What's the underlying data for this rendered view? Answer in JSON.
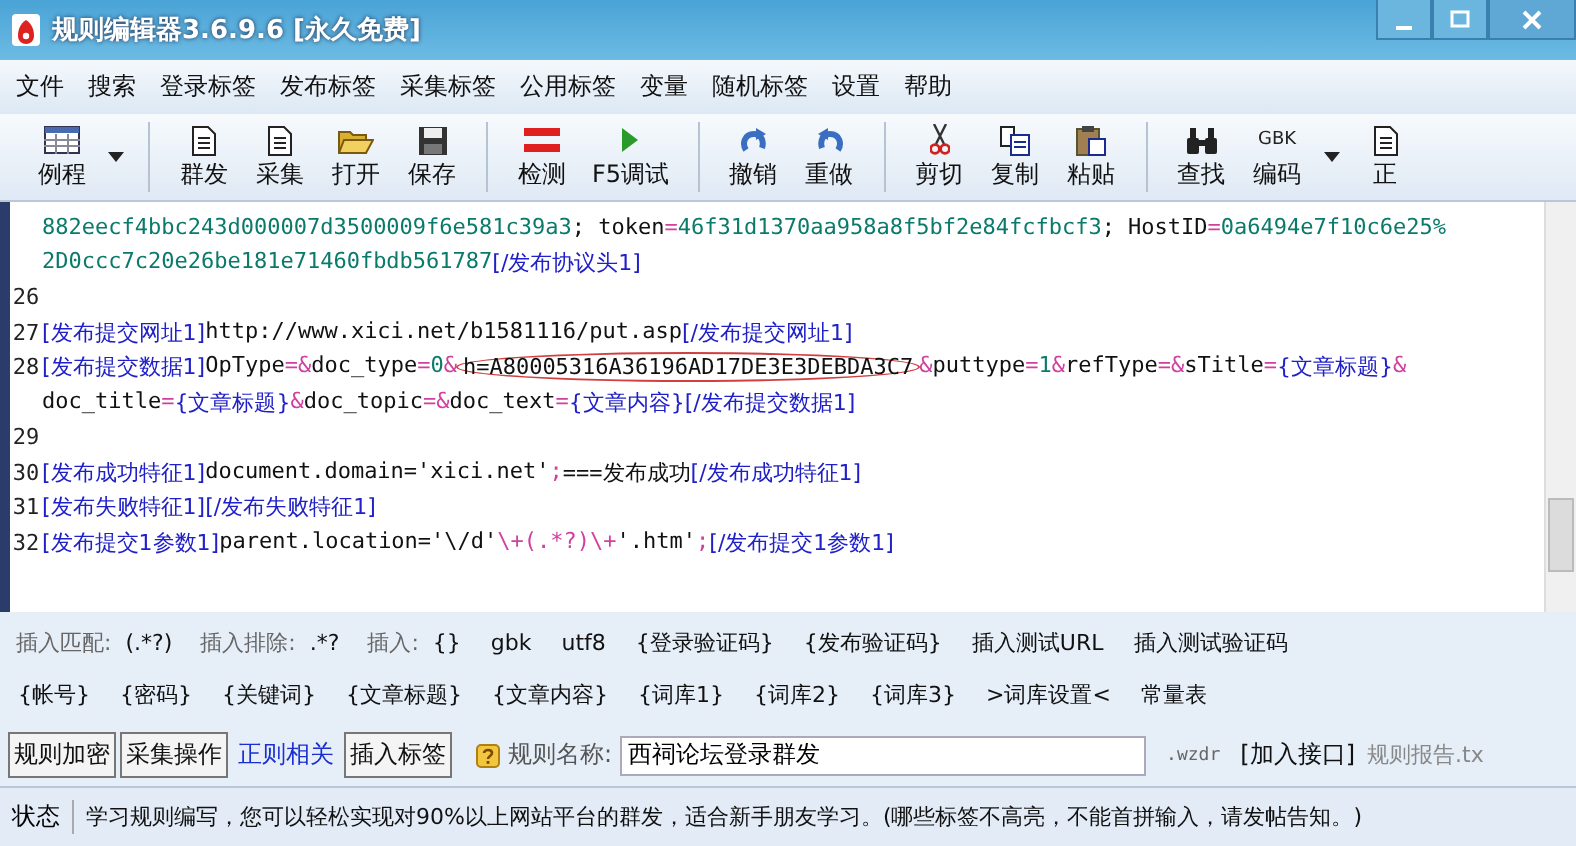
{
  "window": {
    "title": "规则编辑器3.6.9.6 [永久免费]"
  },
  "menu": [
    "文件",
    "搜索",
    "登录标签",
    "发布标签",
    "采集标签",
    "公用标签",
    "变量",
    "随机标签",
    "设置",
    "帮助"
  ],
  "toolbar": [
    {
      "kind": "grid",
      "label": "例程",
      "dropdown": true
    },
    {
      "kind": "sep"
    },
    {
      "kind": "doc",
      "label": "群发"
    },
    {
      "kind": "doc",
      "label": "采集"
    },
    {
      "kind": "folder",
      "label": "打开"
    },
    {
      "kind": "save",
      "label": "保存"
    },
    {
      "kind": "sep"
    },
    {
      "kind": "bars",
      "label": "检测"
    },
    {
      "kind": "play",
      "label": "F5调试"
    },
    {
      "kind": "sep"
    },
    {
      "kind": "undo",
      "label": "撤销"
    },
    {
      "kind": "redo",
      "label": "重做"
    },
    {
      "kind": "sep"
    },
    {
      "kind": "scissors",
      "label": "剪切"
    },
    {
      "kind": "copy",
      "label": "复制"
    },
    {
      "kind": "paste",
      "label": "粘贴"
    },
    {
      "kind": "sep"
    },
    {
      "kind": "binoculars",
      "label": "查找"
    },
    {
      "kind": "text",
      "icon_text": "GBK",
      "label": "编码",
      "dropdown": true
    },
    {
      "kind": "doc",
      "label": "正"
    }
  ],
  "editor": {
    "lines": [
      {
        "segments": [
          {
            "kind": "value",
            "text": "882eecf4bbc243d000007d3500009f6e581c39a3"
          },
          {
            "kind": "text",
            "text": "; token"
          },
          {
            "kind": "op",
            "text": "="
          },
          {
            "kind": "value",
            "text": "46f31d1370aa958a8f5bf2e84fcfbcf3"
          },
          {
            "kind": "text",
            "text": "; HostID"
          },
          {
            "kind": "op",
            "text": "="
          },
          {
            "kind": "value",
            "text": "0a6494e7f10c6e25%"
          }
        ]
      },
      {
        "segments": [
          {
            "kind": "value",
            "text": "2D0ccc7c20e26be181e71460fbdb561787"
          },
          {
            "kind": "tag",
            "text": "[/发布协议头1]"
          }
        ]
      },
      {
        "number": "26"
      },
      {
        "number": "27",
        "segments": [
          {
            "kind": "tag",
            "text": "[发布提交网址1]"
          },
          {
            "kind": "text",
            "text": "http://www.xici.net/b1581116/put.asp"
          },
          {
            "kind": "tag",
            "text": "[/发布提交网址1]"
          }
        ]
      },
      {
        "number": "28",
        "segments": [
          {
            "kind": "tag",
            "text": "[发布提交数据1]"
          },
          {
            "kind": "text",
            "text": "OpType"
          },
          {
            "kind": "op",
            "text": "=&"
          },
          {
            "kind": "text",
            "text": "doc_type"
          },
          {
            "kind": "op",
            "text": "="
          },
          {
            "kind": "value",
            "text": "0"
          },
          {
            "kind": "op",
            "text": "&"
          },
          {
            "kind": "text",
            "text": "h=A80005316A36196AD17DE3E3DEBDA3C7",
            "circled": true
          },
          {
            "kind": "op",
            "text": "&"
          },
          {
            "kind": "text",
            "text": "puttype"
          },
          {
            "kind": "op",
            "text": "="
          },
          {
            "kind": "value",
            "text": "1"
          },
          {
            "kind": "op",
            "text": "&"
          },
          {
            "kind": "text",
            "text": "refType"
          },
          {
            "kind": "op",
            "text": "=&"
          },
          {
            "kind": "text",
            "text": "sTitle"
          },
          {
            "kind": "op",
            "text": "="
          },
          {
            "kind": "tag",
            "text": "{文章标题}"
          },
          {
            "kind": "op",
            "text": "&"
          }
        ]
      },
      {
        "segments": [
          {
            "kind": "text",
            "text": "doc_title"
          },
          {
            "kind": "op",
            "text": "="
          },
          {
            "kind": "tag",
            "text": "{文章标题}"
          },
          {
            "kind": "op",
            "text": "&"
          },
          {
            "kind": "text",
            "text": "doc_topic"
          },
          {
            "kind": "op",
            "text": "=&"
          },
          {
            "kind": "text",
            "text": "doc_text"
          },
          {
            "kind": "op",
            "text": "="
          },
          {
            "kind": "tag",
            "text": "{文章内容}"
          },
          {
            "kind": "tag",
            "text": "[/发布提交数据1]"
          }
        ]
      },
      {
        "number": "29"
      },
      {
        "number": "30",
        "segments": [
          {
            "kind": "tag",
            "text": "[发布成功特征1]"
          },
          {
            "kind": "text",
            "text": "document.domain='xici.net'"
          },
          {
            "kind": "op",
            "text": ";"
          },
          {
            "kind": "text",
            "text": "===发布成功"
          },
          {
            "kind": "tag",
            "text": "[/发布成功特征1]"
          }
        ]
      },
      {
        "number": "31",
        "segments": [
          {
            "kind": "tag",
            "text": "[发布失败特征1]"
          },
          {
            "kind": "tag",
            "text": "[/发布失败特征1]"
          }
        ]
      },
      {
        "number": "32",
        "segments": [
          {
            "kind": "tag",
            "text": "[发布提交1参数1]"
          },
          {
            "kind": "text",
            "text": "parent.location='\\/d'"
          },
          {
            "kind": "op",
            "text": "\\+(.*?)\\+"
          },
          {
            "kind": "text",
            "text": "'.htm'"
          },
          {
            "kind": "op",
            "text": ";"
          },
          {
            "kind": "tag",
            "text": "[/发布提交1参数1]"
          }
        ]
      }
    ]
  },
  "insert_rows": [
    [
      {
        "kind": "label",
        "text": "插入匹配:"
      },
      {
        "kind": "button",
        "text": "(.*?)"
      },
      {
        "kind": "label",
        "text": "插入排除:"
      },
      {
        "kind": "button",
        "text": ".*?"
      },
      {
        "kind": "label",
        "text": "插入:"
      },
      {
        "kind": "button",
        "text": "{}"
      },
      {
        "kind": "button",
        "text": "gbk"
      },
      {
        "kind": "button",
        "text": "utf8"
      },
      {
        "kind": "button",
        "text": "{登录验证码}"
      },
      {
        "kind": "button",
        "text": "{发布验证码}"
      },
      {
        "kind": "button",
        "text": "插入测试URL"
      },
      {
        "kind": "button",
        "text": "插入测试验证码"
      }
    ],
    [
      {
        "kind": "button",
        "text": "{帐号}"
      },
      {
        "kind": "button",
        "text": "{密码}"
      },
      {
        "kind": "button",
        "text": "{关键词}"
      },
      {
        "kind": "button",
        "text": "{文章标题}"
      },
      {
        "kind": "button",
        "text": "{文章内容}"
      },
      {
        "kind": "button",
        "text": "{词库1}"
      },
      {
        "kind": "button",
        "text": "{词库2}"
      },
      {
        "kind": "button",
        "text": "{词库3}"
      },
      {
        "kind": "button",
        "text": ">词库设置<"
      },
      {
        "kind": "button",
        "text": "常量表"
      }
    ]
  ],
  "tabs": [
    {
      "label": "规则加密",
      "selected": false
    },
    {
      "label": "采集操作",
      "selected": false
    },
    {
      "label": "正则相关",
      "selected": true
    },
    {
      "label": "插入标签",
      "selected": false
    }
  ],
  "rule_name": {
    "label": "规则名称:",
    "value": "西祠论坛登录群发"
  },
  "extension": ".wzdr",
  "add_interface": "[加入接口]",
  "report": "规则报告.tx",
  "status_bar": {
    "label": "状态",
    "message": "学习规则编写，您可以轻松实现对90%以上网站平台的群发，适合新手朋友学习。(哪些标签不高亮，不能首拼输入，请发帖告知。)"
  }
}
